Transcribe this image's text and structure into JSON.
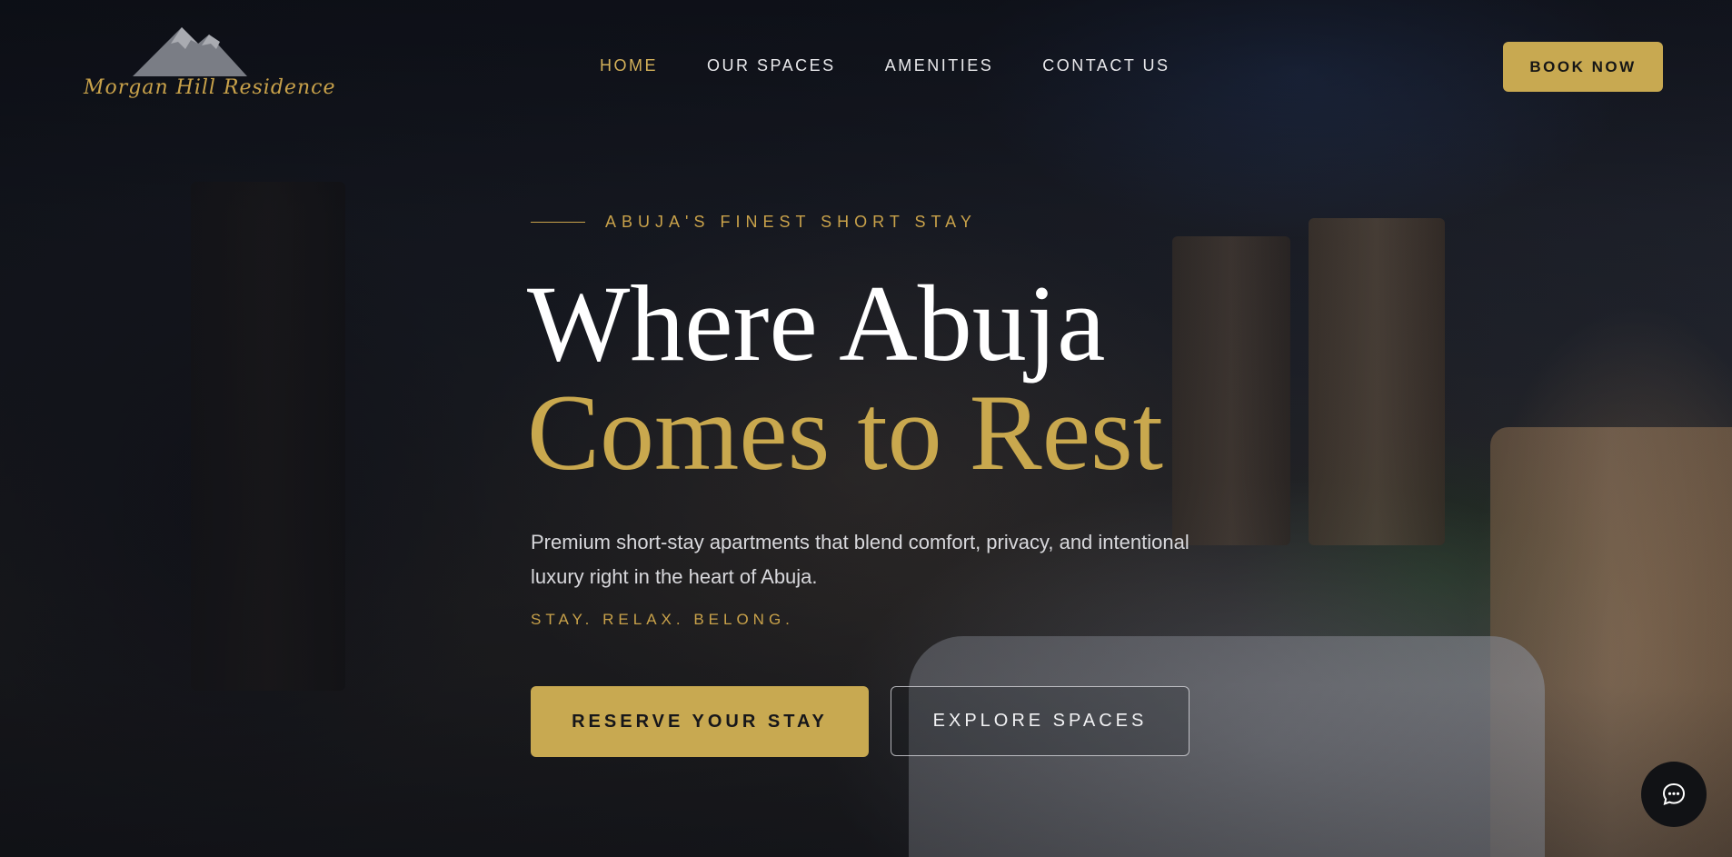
{
  "brand": {
    "logo_text": "Morgan Hill  Residence",
    "accent_color": "#c8a951"
  },
  "nav": {
    "items": [
      {
        "label": "HOME",
        "active": true
      },
      {
        "label": "OUR SPACES",
        "active": false
      },
      {
        "label": "AMENITIES",
        "active": false
      },
      {
        "label": "CONTACT US",
        "active": false
      }
    ],
    "cta_label": "BOOK NOW"
  },
  "hero": {
    "eyebrow": "ABUJA'S FINEST SHORT STAY",
    "title_line1": "Where Abuja",
    "title_line2": "Comes to Rest",
    "description": "Premium short-stay apartments that blend comfort, privacy, and intentional luxury right in the heart of Abuja.",
    "tagline": "STAY. RELAX. BELONG.",
    "primary_button": "RESERVE YOUR STAY",
    "secondary_button": "EXPLORE SPACES"
  },
  "chat": {
    "icon": "chat-bubble-icon"
  }
}
